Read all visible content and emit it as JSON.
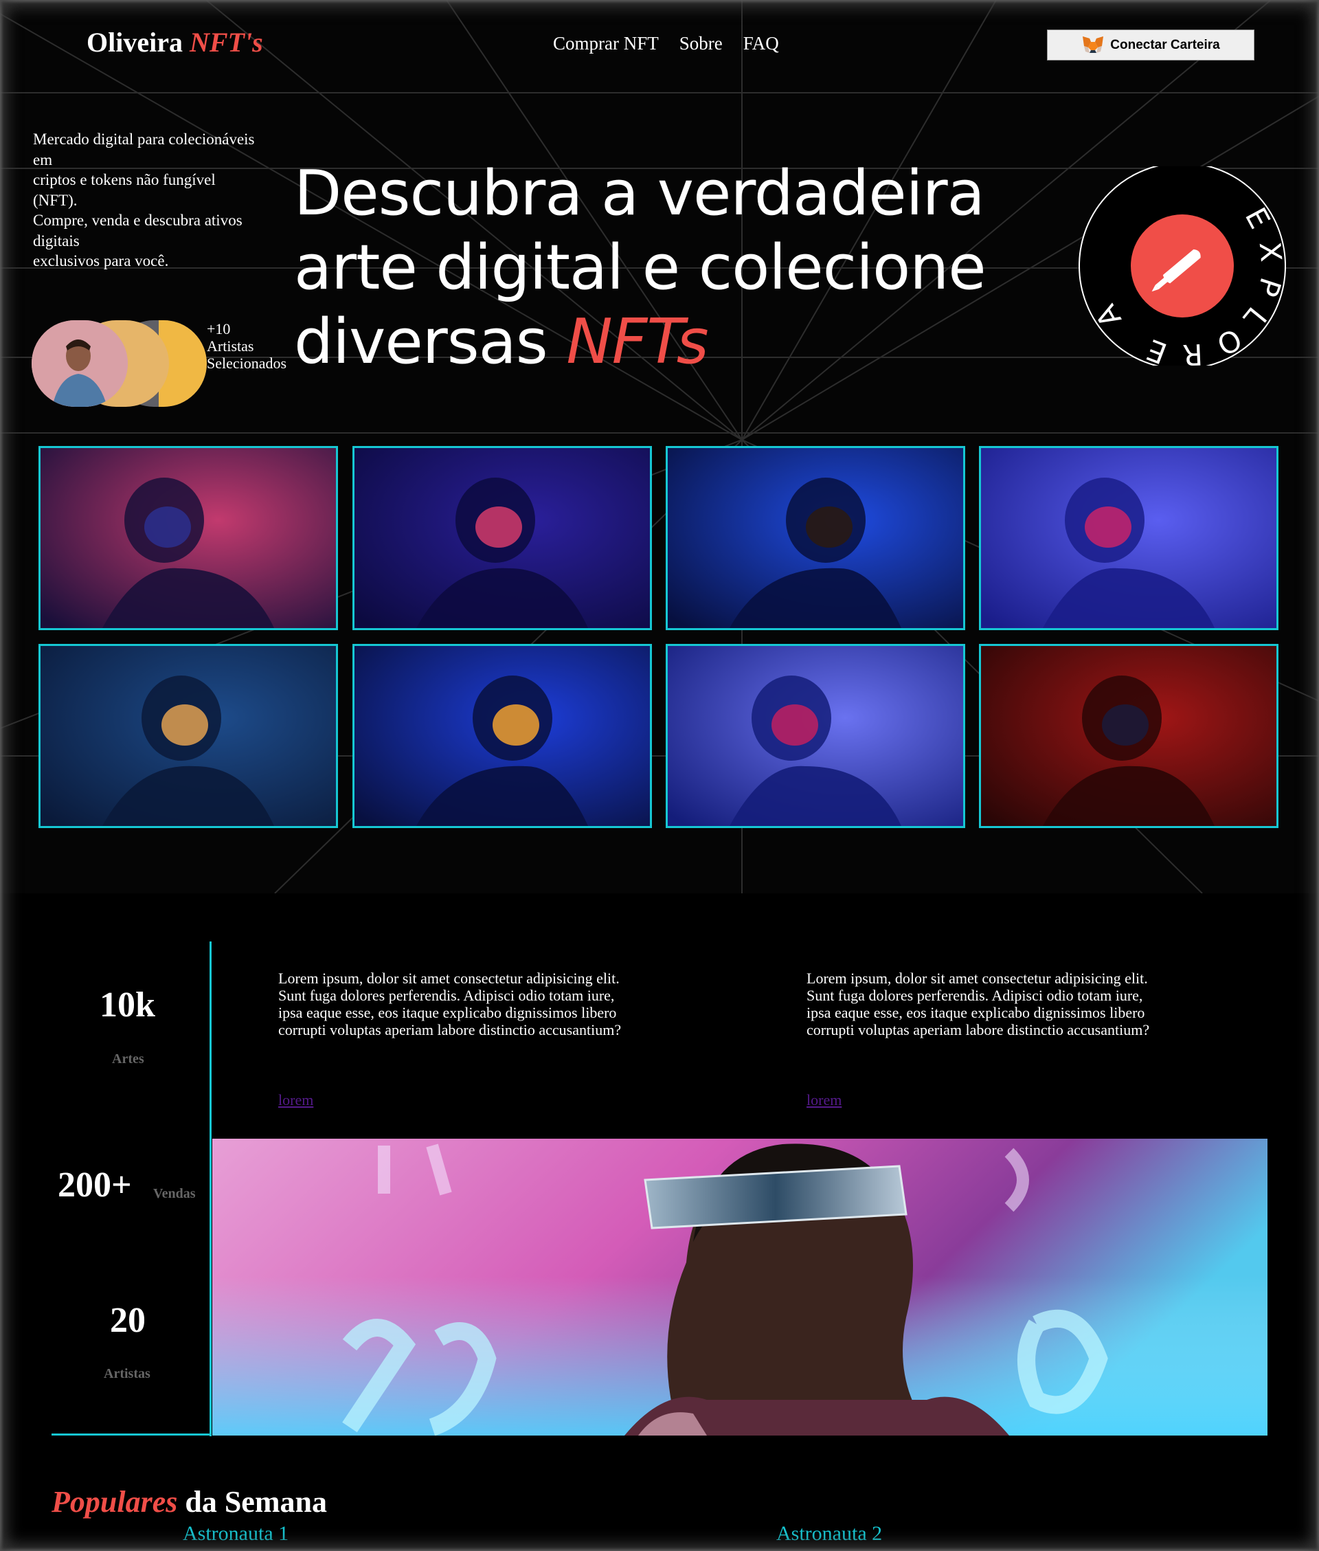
{
  "header": {
    "logo_name": "Oliveira",
    "logo_accent": "NFT's",
    "nav": [
      "Comprar NFT",
      "Sobre",
      "FAQ"
    ],
    "wallet_button": "Conectar Carteira"
  },
  "hero": {
    "intro": [
      "Mercado digital para colecionáveis",
      "em",
      "criptos e tokens não fungível",
      "(NFT).",
      "Compre, venda e descubra ativos",
      "digitais",
      "exclusivos para você."
    ],
    "artists_line1": "+10",
    "artists_line2": "Artistas",
    "artists_line3": "Selecionados",
    "headline_line1": "Descubra a verdadeira",
    "headline_line2": "arte digital e colecione",
    "headline_line3_prefix": "diversas ",
    "headline_accent": "NFTs",
    "badge_text": "EXPLORE A ARTE"
  },
  "gallery": [
    {
      "name": "astronaut-1",
      "colors": [
        "#1a0f3a",
        "#c23a6e",
        "#2b2f8e"
      ]
    },
    {
      "name": "astronaut-2",
      "colors": [
        "#0c0a40",
        "#2a1f9a",
        "#d23b6a"
      ]
    },
    {
      "name": "astronaut-3",
      "colors": [
        "#071040",
        "#1f4be0",
        "#2a1a10"
      ]
    },
    {
      "name": "astronaut-4",
      "colors": [
        "#1a1d8a",
        "#5a5ef0",
        "#c7236a"
      ]
    },
    {
      "name": "astronaut-5",
      "colors": [
        "#0a1a3a",
        "#1d4b8a",
        "#e0a050"
      ]
    },
    {
      "name": "astronaut-6",
      "colors": [
        "#081040",
        "#1d3dd8",
        "#f0a030"
      ]
    },
    {
      "name": "astronaut-7",
      "colors": [
        "#141d7a",
        "#6a72f0",
        "#c02060"
      ]
    },
    {
      "name": "astronaut-8",
      "colors": [
        "#2a0606",
        "#a01616",
        "#1a1a3a"
      ]
    }
  ],
  "stats": [
    {
      "value": "10k",
      "label": "Artes"
    },
    {
      "value": "200+",
      "label": "Vendas"
    },
    {
      "value": "20",
      "label": "Artistas"
    }
  ],
  "lorem_blocks": [
    {
      "text": [
        "Lorem ipsum, dolor sit amet consectetur adipisicing elit.",
        "Sunt fuga dolores perferendis. Adipisci odio totam iure,",
        "ipsa eaque esse, eos itaque explicabo dignissimos libero",
        "corrupti voluptas aperiam labore distinctio accusantium?"
      ],
      "link": "lorem"
    },
    {
      "text": [
        "Lorem ipsum, dolor sit amet consectetur adipisicing elit.",
        "Sunt fuga dolores perferendis. Adipisci odio totam iure,",
        "ipsa eaque esse, eos itaque explicabo dignissimos libero",
        "corrupti voluptas aperiam labore distinctio accusantium?"
      ],
      "link": "lorem"
    }
  ],
  "popular": {
    "title_accent": "Populares",
    "title_rest": " da Semana",
    "items": [
      "Astronauta 1",
      "Astronauta 2"
    ]
  },
  "colors": {
    "accent": "#f04e48",
    "cyan": "#16c7d3",
    "link": "#551a8b"
  }
}
